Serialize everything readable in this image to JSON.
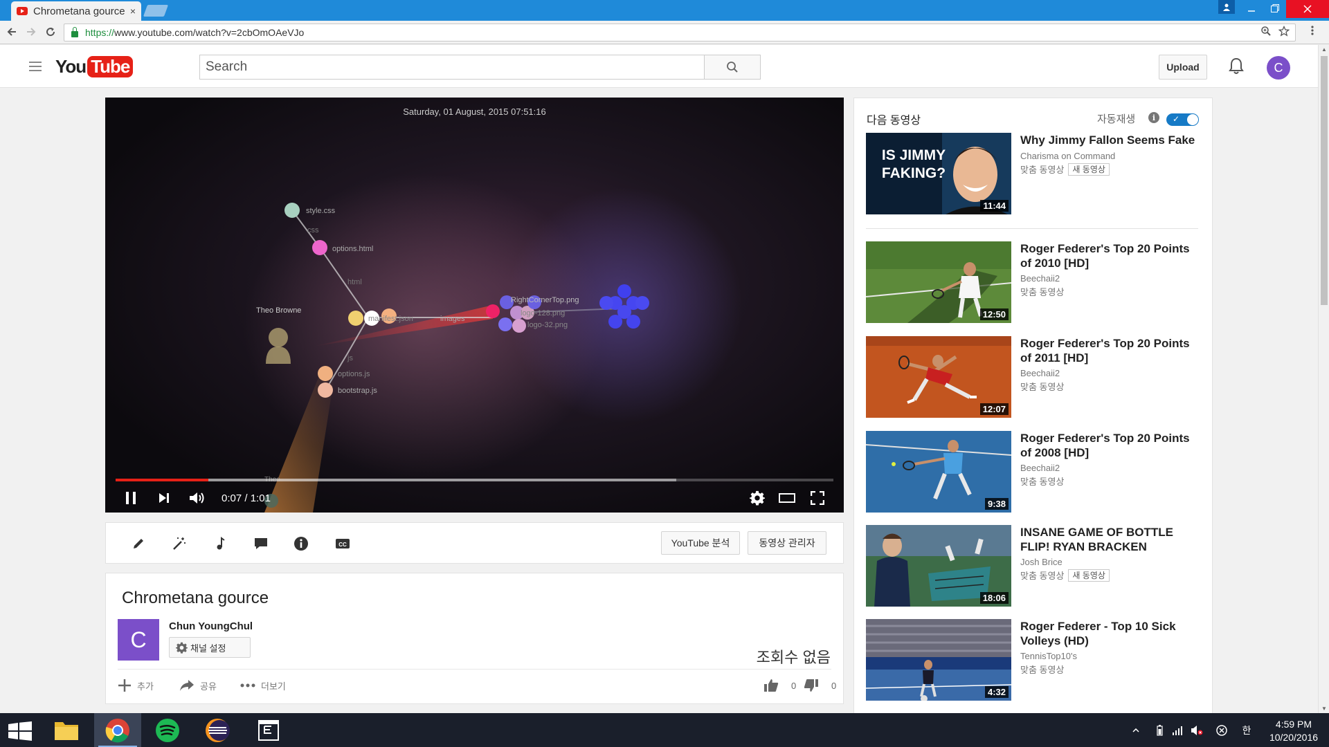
{
  "browser": {
    "tab_title": "Chrometana gource",
    "tab_close": "×",
    "url_scheme": "https://",
    "url_rest": "www.youtube.com/watch?v=2cbOmOAeVJo"
  },
  "masthead": {
    "logo_you": "You",
    "logo_tube": "Tube",
    "search_placeholder": "Search",
    "upload_label": "Upload",
    "avatar_letter": "C"
  },
  "player": {
    "overlay_date": "Saturday, 01 August, 2015 07:51:16",
    "time_current": "0:07",
    "time_separator": " / ",
    "time_total": "1:01",
    "progress_played_fraction": 0.129,
    "progress_buffered_fraction": 0.781,
    "gource_labels": {
      "style_css": "style.css",
      "css": "css",
      "options_html": "options.html",
      "html": "html",
      "user": "Theo Browne",
      "manifest": "manifest.json",
      "images": "images",
      "js": "js",
      "options_js": "options.js",
      "bootstrap_js": "bootstrap.js",
      "right_corner": "RightCornerTop.png",
      "logo128": "logo-128.png",
      "logo32": "logo-32.png",
      "theo_small": "Theo"
    }
  },
  "action_bar": {
    "analytics_label": "YouTube 분석",
    "manager_label": "동영상 관리자"
  },
  "video_info": {
    "title": "Chrometana gource",
    "channel_name": "Chun YoungChul",
    "channel_avatar_letter": "C",
    "channel_settings_label": "채널 설정",
    "views": "조회수 없음",
    "add_label": "추가",
    "share_label": "공유",
    "more_label": "더보기",
    "likes": "0",
    "dislikes": "0"
  },
  "sidebar": {
    "up_next": "다음 동영상",
    "autoplay_label": "자동재생",
    "autoplay_info": "i",
    "autoplay_on": true,
    "videos": [
      {
        "title": "Why Jimmy Fallon Seems Fake",
        "channel": "Charisma on Command",
        "meta": "맞춤 동영상",
        "badge": "새 동영상",
        "duration": "11:44",
        "thumb_text": "IS JIMMY FAKING?"
      },
      {
        "title": "Roger Federer's Top 20 Points of 2010 [HD]",
        "channel": "Beechaii2",
        "meta": "맞춤 동영상",
        "badge": "",
        "duration": "12:50"
      },
      {
        "title": "Roger Federer's Top 20 Points of 2011 [HD]",
        "channel": "Beechaii2",
        "meta": "맞춤 동영상",
        "badge": "",
        "duration": "12:07"
      },
      {
        "title": "Roger Federer's Top 20 Points of 2008 [HD]",
        "channel": "Beechaii2",
        "meta": "맞춤 동영상",
        "badge": "",
        "duration": "9:38"
      },
      {
        "title": "INSANE GAME OF BOTTLE FLIP! RYAN BRACKEN",
        "channel": "Josh Brice",
        "meta": "맞춤 동영상",
        "badge": "새 동영상",
        "duration": "18:06"
      },
      {
        "title": "Roger Federer - Top 10 Sick Volleys (HD)",
        "channel": "TennisTop10's",
        "meta": "맞춤 동영상",
        "badge": "",
        "duration": "4:32"
      }
    ]
  },
  "taskbar": {
    "time": "4:59 PM",
    "date": "10/20/2016",
    "ime": "한"
  }
}
